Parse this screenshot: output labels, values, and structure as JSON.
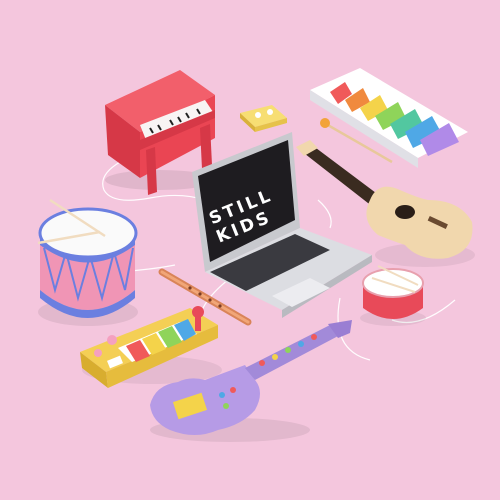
{
  "laptop": {
    "screen_line1": "STILL",
    "screen_line2": "KIDS"
  },
  "colors": {
    "background": "#f4c6dd",
    "piano_red": "#ea4553",
    "drum_pink": "#f095b5",
    "drum_blue": "#6b7fe0",
    "guitar_purple": "#b69be6",
    "ukulele_wood": "#f1d7ad",
    "laptop_silver": "#dcdde2",
    "screen_dark": "#1e1c20",
    "toy_yellow": "#f4cf55",
    "cassette_yellow": "#f2d24b"
  },
  "icons": [
    "piano",
    "cassette",
    "xylophone",
    "mallet",
    "drum",
    "laptop",
    "ukulele",
    "flute",
    "small-drum",
    "toy-xylophone",
    "toy-guitar"
  ]
}
